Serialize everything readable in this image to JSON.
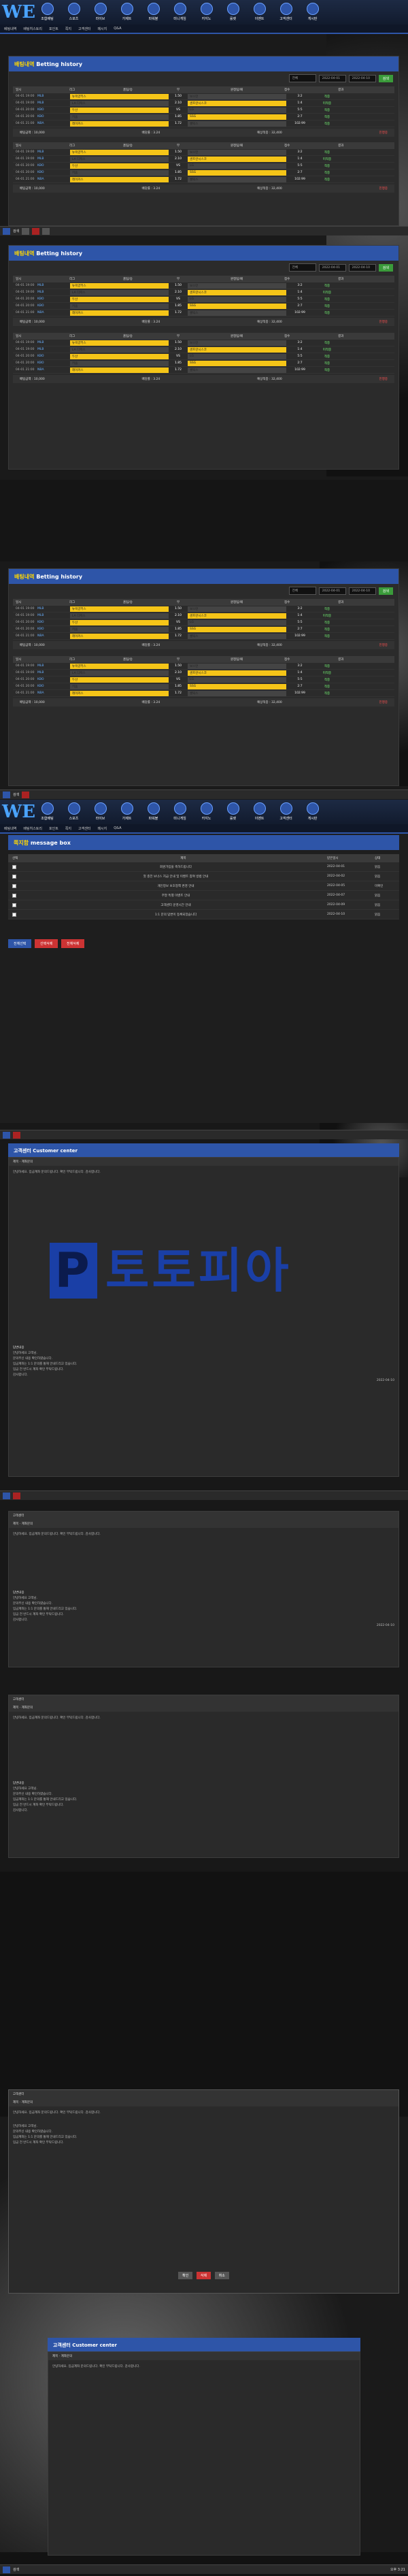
{
  "nav": {
    "items": [
      "조합배팅",
      "스포츠",
      "라이브",
      "가제트",
      "파워볼",
      "미니게임",
      "카지노",
      "룰렛",
      "이벤트",
      "고객센터",
      "게시판"
    ],
    "sub": [
      "베팅내역",
      "배팅히스토리",
      "포인트",
      "쪽지",
      "고객센터",
      "메시지",
      "Q&A"
    ]
  },
  "betting": {
    "title_ko": "배팅내역",
    "title_en": "Betting history",
    "filter": "전체",
    "date_from": "2022-04-01",
    "date_to": "2022-04-10",
    "search": "검색",
    "headers": [
      "일시",
      "리그",
      "홈팀/승",
      "무",
      "원정팀/패",
      "점수",
      "결과"
    ],
    "rows": [
      {
        "dt": "04-01 19:00",
        "lg": "MLB",
        "home": "뉴욕양키스",
        "draw": "1.50",
        "away": "보스턴",
        "sc": "3:2",
        "rs": "적중"
      },
      {
        "dt": "04-01 19:00",
        "lg": "MLB",
        "home": "LA 다저스",
        "draw": "2.10",
        "away": "샌프란시스코",
        "sc": "1:4",
        "rs": "미적중"
      },
      {
        "dt": "04-01 20:00",
        "lg": "KBO",
        "home": "두산",
        "draw": "VS",
        "away": "LG",
        "sc": "5:5",
        "rs": "적중"
      },
      {
        "dt": "04-01 20:00",
        "lg": "KBO",
        "home": "키움",
        "draw": "1.85",
        "away": "SSG",
        "sc": "2:7",
        "rs": "적중"
      },
      {
        "dt": "04-01 21:00",
        "lg": "NBA",
        "home": "레이커스",
        "draw": "1.72",
        "away": "셀틱스",
        "sc": "102:99",
        "rs": "적중"
      }
    ],
    "summary": {
      "bet": "배팅금액 : 10,000",
      "odds": "배당률 : 3.24",
      "win": "예상적중 : 32,400",
      "status": "진행중"
    },
    "delete": "삭제"
  },
  "msg": {
    "title_ko": "쪽지함",
    "title_en": "message box",
    "headers": [
      "선택",
      "제목",
      "받은일시",
      "상태"
    ],
    "rows": [
      [
        "회원가입을 축하드립니다",
        "2022-04-01",
        "읽음"
      ],
      [
        "첫 충전 보너스 지급 안내 및 이벤트 참여 방법 안내",
        "2022-04-02",
        "읽음"
      ],
      [
        "개인정보 보호정책 변경 안내",
        "2022-04-05",
        "미확인"
      ],
      [
        "주말 특별 이벤트 안내",
        "2022-04-07",
        "읽음"
      ],
      [
        "고객센터 운영시간 안내",
        "2022-04-09",
        "읽음"
      ],
      [
        "1:1 문의 답변이 등록되었습니다",
        "2022-04-10",
        "읽음"
      ]
    ],
    "buttons": [
      "전체선택",
      "선택삭제",
      "전체삭제"
    ]
  },
  "cc": {
    "title_ko": "고객센터",
    "title_en": "Customer center",
    "subject_label": "제목",
    "subject": "계좌문의",
    "question": "안녕하세요. 입금계좌 문의드립니다. 확인 부탁드립니다. 감사합니다.",
    "reply_label": "답변내용",
    "reply_lines": [
      "안녕하세요 고객님.",
      "문의주신 내용 확인하였습니다.",
      "입금계좌는 1:1 문의를 통해 안내드리고 있습니다.",
      "입금 전 반드시 계좌 확인 부탁드립니다.",
      "감사합니다."
    ],
    "reply_date": "2022-04-10",
    "watermark": "토토피아",
    "dialog_buttons": [
      "확인",
      "삭제",
      "취소"
    ]
  },
  "taskbar": {
    "search": "검색",
    "time": "오후 3:21"
  },
  "colors": {
    "accent": "#2e55a8",
    "yellow": "#f5c518",
    "green": "#3a9b3a",
    "red": "#cc3333"
  }
}
